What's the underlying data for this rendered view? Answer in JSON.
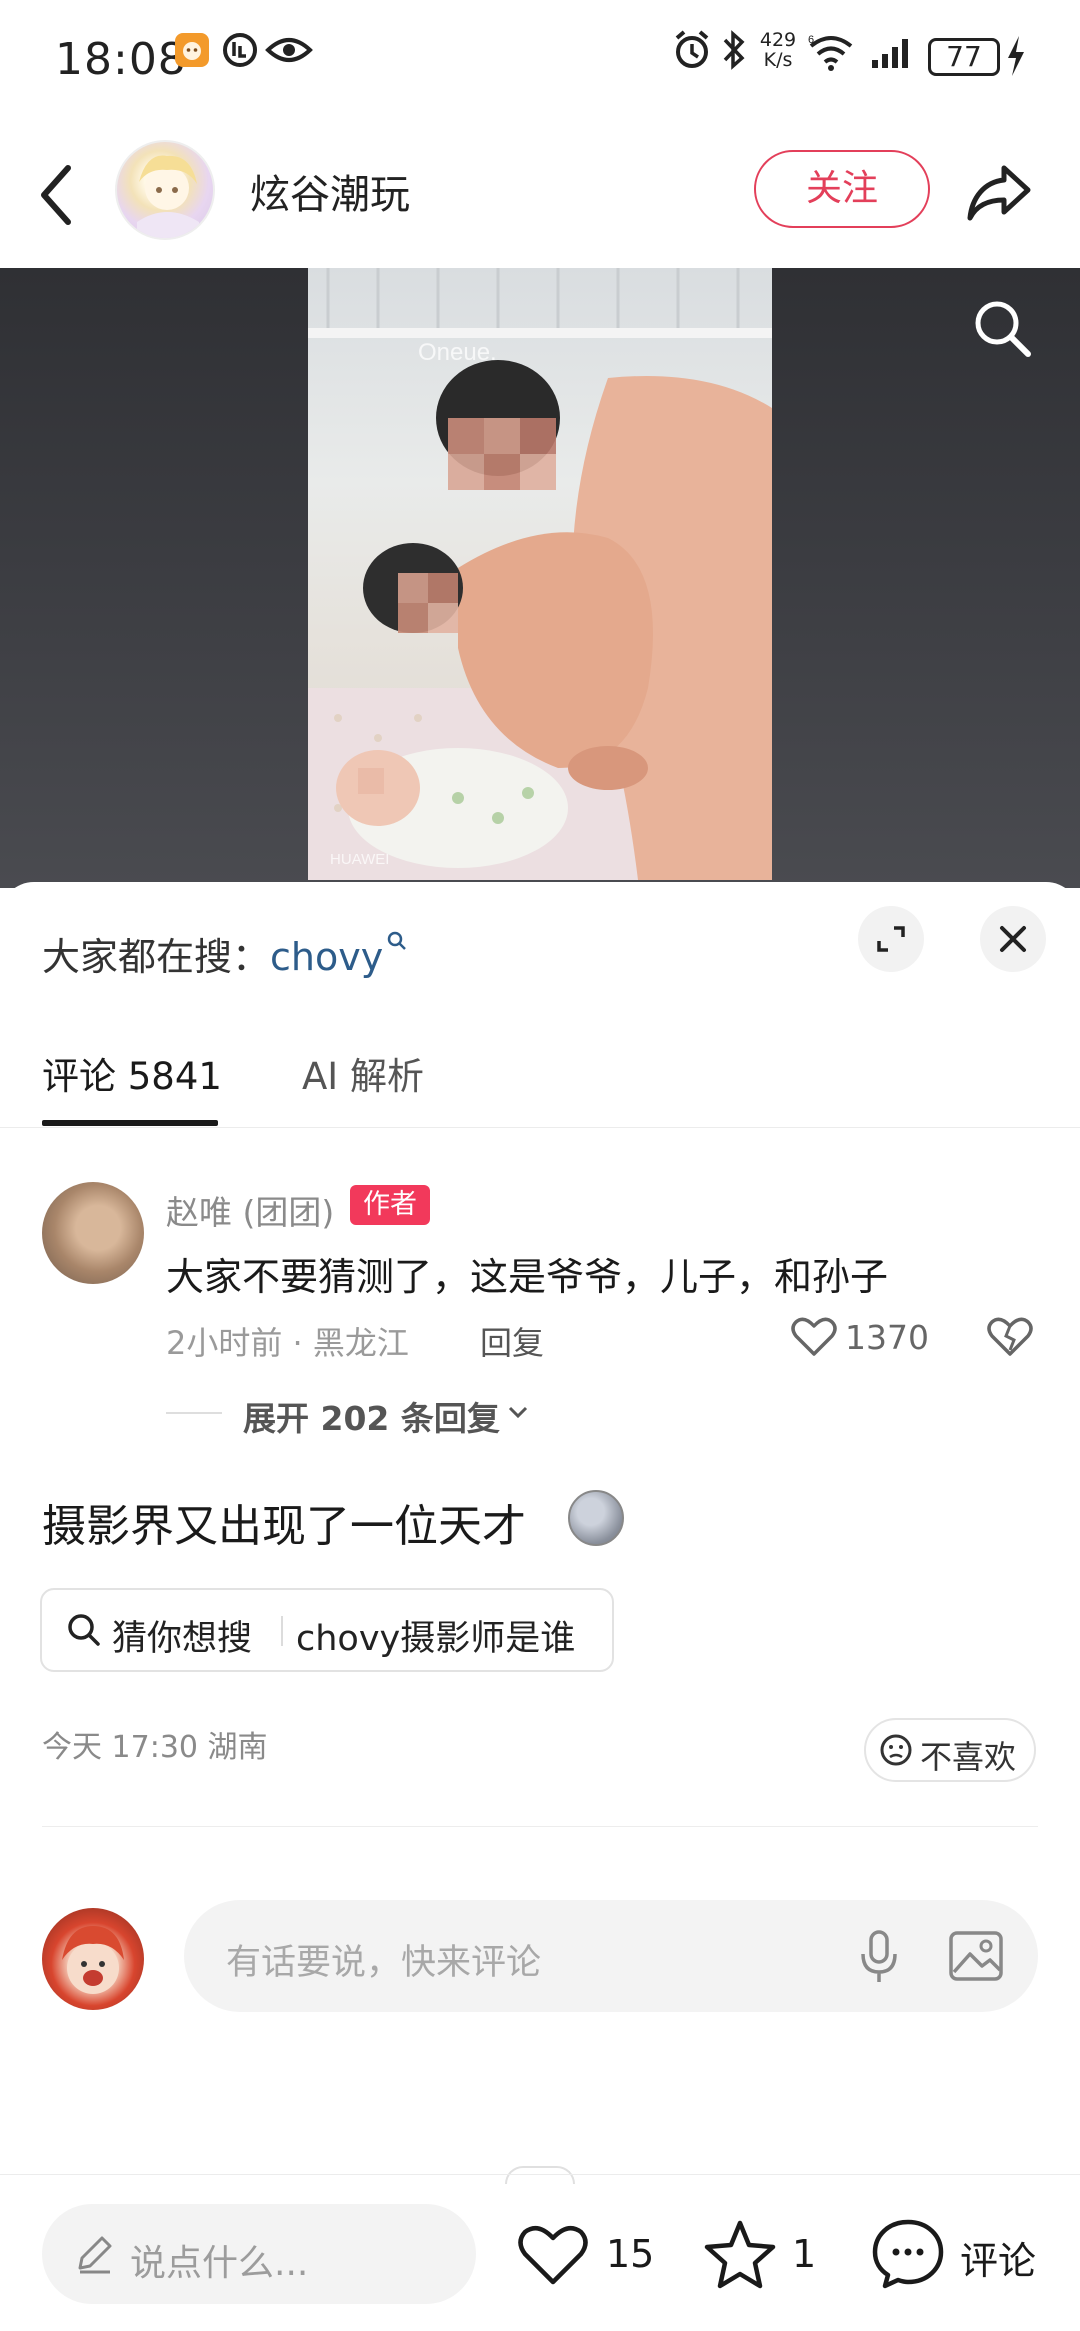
{
  "status_bar": {
    "time": "18:08",
    "net_speed_top": "429",
    "net_speed_bottom": "K/s",
    "battery": "77"
  },
  "header": {
    "author_name": "炫谷潮玩",
    "follow_label": "关注"
  },
  "media": {
    "watermark_top": "Oneue.",
    "watermark_bottom": "HUAWEI"
  },
  "sheet": {
    "search_prefix": "大家都在搜：",
    "search_keyword": "chovy",
    "tabs": [
      {
        "label": "评论 5841",
        "active": true
      },
      {
        "label": "AI 解析",
        "active": false
      }
    ]
  },
  "comment": {
    "user": "赵唯 (团团)",
    "badge": "作者",
    "text": "大家不要猜测了，这是爷爷，儿子，和孙子",
    "meta": "2小时前 · 黑龙江",
    "reply_label": "回复",
    "likes": "1370",
    "expand_label": "展开 202 条回复"
  },
  "post": {
    "text": "摄影界又出现了一位天才",
    "suggest_label": "猜你想搜",
    "suggest_query": "chovy摄影师是谁",
    "meta": "今天 17:30 湖南",
    "dislike_label": "不喜欢"
  },
  "compose": {
    "placeholder": "有话要说，快来评论"
  },
  "bottom_bar": {
    "placeholder": "说点什么...",
    "likes": "15",
    "favorites": "1",
    "comment_label": "评论"
  },
  "colors": {
    "accent": "#e33f5a",
    "badge": "#f2395b",
    "keyword": "#2d5c8a"
  }
}
